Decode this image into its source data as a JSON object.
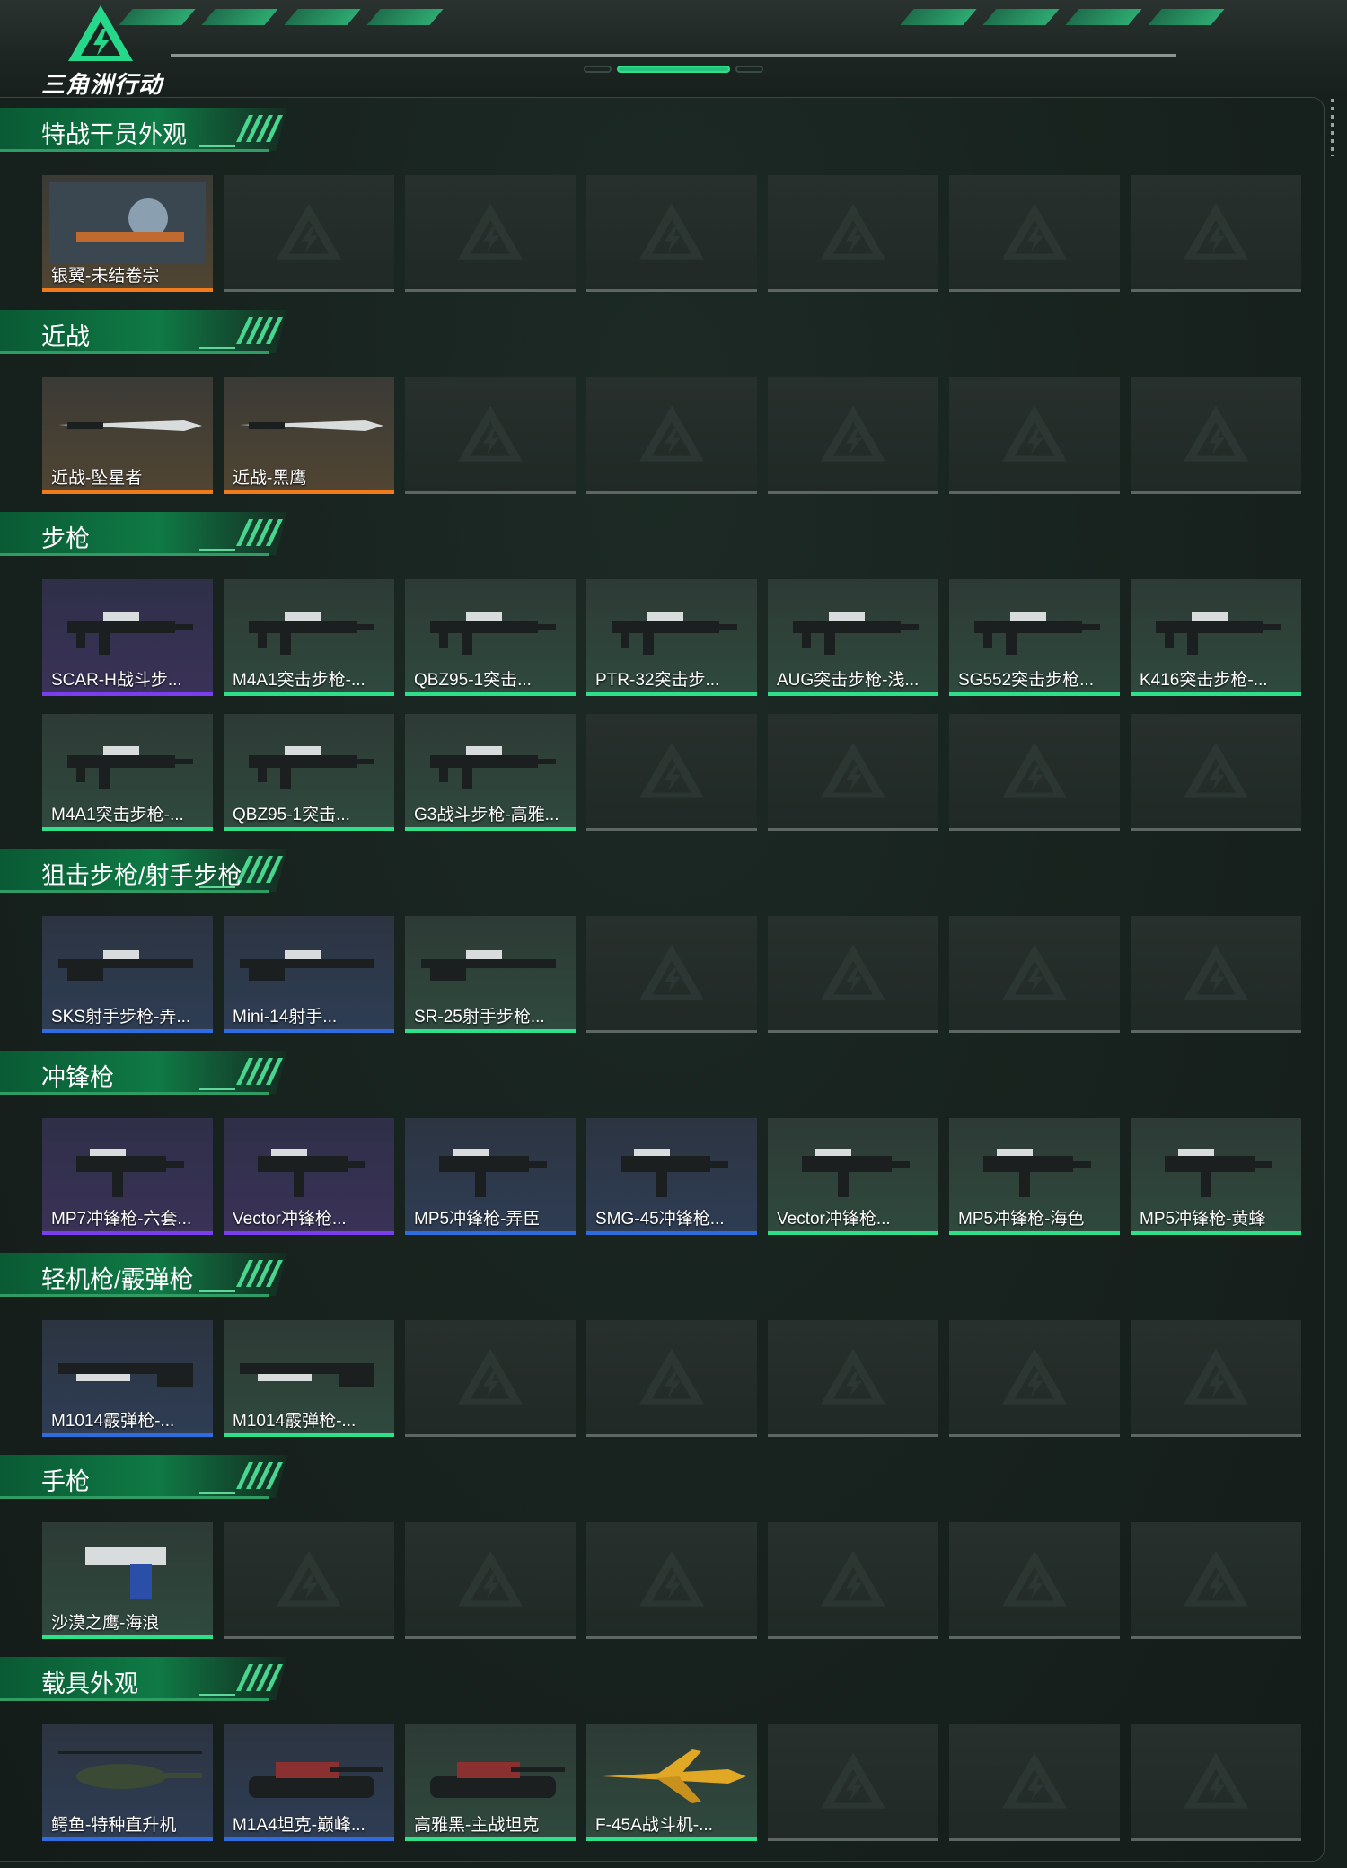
{
  "app": {
    "logo_text": "三角洲行动"
  },
  "colors": {
    "gold": "#f07a1c",
    "purple": "#7a3df0",
    "blue": "#2f6ce0",
    "green": "#2fe08a",
    "empty": "#5c6763"
  },
  "sections": [
    {
      "title": "特战干员外观",
      "items": [
        {
          "label": "银翼-未结卷宗",
          "rarity": "gold",
          "icon": "operator-skin-icon"
        }
      ]
    },
    {
      "title": "近战",
      "items": [
        {
          "label": "近战-坠星者",
          "rarity": "gold",
          "icon": "knife-icon"
        },
        {
          "label": "近战-黑鹰",
          "rarity": "gold",
          "icon": "knife-icon"
        }
      ]
    },
    {
      "title": "步枪",
      "items": [
        {
          "label": "SCAR-H战斗步...",
          "rarity": "purple",
          "icon": "rifle-icon"
        },
        {
          "label": "M4A1突击步枪-...",
          "rarity": "green",
          "icon": "rifle-icon"
        },
        {
          "label": "QBZ95-1突击...",
          "rarity": "green",
          "icon": "rifle-icon"
        },
        {
          "label": "PTR-32突击步...",
          "rarity": "green",
          "icon": "rifle-icon"
        },
        {
          "label": "AUG突击步枪-浅...",
          "rarity": "green",
          "icon": "rifle-icon"
        },
        {
          "label": "SG552突击步枪...",
          "rarity": "green",
          "icon": "rifle-icon"
        },
        {
          "label": "K416突击步枪-...",
          "rarity": "green",
          "icon": "rifle-icon"
        },
        {
          "label": "M4A1突击步枪-...",
          "rarity": "green",
          "icon": "rifle-icon"
        },
        {
          "label": "QBZ95-1突击...",
          "rarity": "green",
          "icon": "rifle-icon"
        },
        {
          "label": "G3战斗步枪-高雅...",
          "rarity": "green",
          "icon": "rifle-icon"
        }
      ]
    },
    {
      "title": "狙击步枪/射手步枪",
      "items": [
        {
          "label": "SKS射手步枪-弄...",
          "rarity": "blue",
          "icon": "marksman-rifle-icon"
        },
        {
          "label": "Mini-14射手...",
          "rarity": "blue",
          "icon": "marksman-rifle-icon"
        },
        {
          "label": "SR-25射手步枪...",
          "rarity": "green",
          "icon": "marksman-rifle-icon"
        }
      ]
    },
    {
      "title": "冲锋枪",
      "items": [
        {
          "label": "MP7冲锋枪-六套...",
          "rarity": "purple",
          "icon": "smg-icon"
        },
        {
          "label": "Vector冲锋枪...",
          "rarity": "purple",
          "icon": "smg-icon"
        },
        {
          "label": "MP5冲锋枪-弄臣",
          "rarity": "blue",
          "icon": "smg-icon"
        },
        {
          "label": "SMG-45冲锋枪...",
          "rarity": "blue",
          "icon": "smg-icon"
        },
        {
          "label": "Vector冲锋枪...",
          "rarity": "green",
          "icon": "smg-icon"
        },
        {
          "label": "MP5冲锋枪-海色",
          "rarity": "green",
          "icon": "smg-icon"
        },
        {
          "label": "MP5冲锋枪-黄蜂",
          "rarity": "green",
          "icon": "smg-icon"
        }
      ]
    },
    {
      "title": "轻机枪/霰弹枪",
      "items": [
        {
          "label": "M1014霰弹枪-...",
          "rarity": "blue",
          "icon": "shotgun-icon"
        },
        {
          "label": "M1014霰弹枪-...",
          "rarity": "green",
          "icon": "shotgun-icon"
        }
      ]
    },
    {
      "title": "手枪",
      "items": [
        {
          "label": "沙漠之鹰-海浪",
          "rarity": "green",
          "icon": "pistol-icon"
        }
      ]
    },
    {
      "title": "载具外观",
      "items": [
        {
          "label": "鳄鱼-特种直升机",
          "rarity": "blue",
          "icon": "helicopter-icon"
        },
        {
          "label": "M1A4坦克-巅峰...",
          "rarity": "blue",
          "icon": "tank-icon"
        },
        {
          "label": "高雅黑-主战坦克",
          "rarity": "green",
          "icon": "tank-icon"
        },
        {
          "label": "F-45A战斗机-...",
          "rarity": "green",
          "icon": "jet-icon"
        }
      ]
    }
  ]
}
